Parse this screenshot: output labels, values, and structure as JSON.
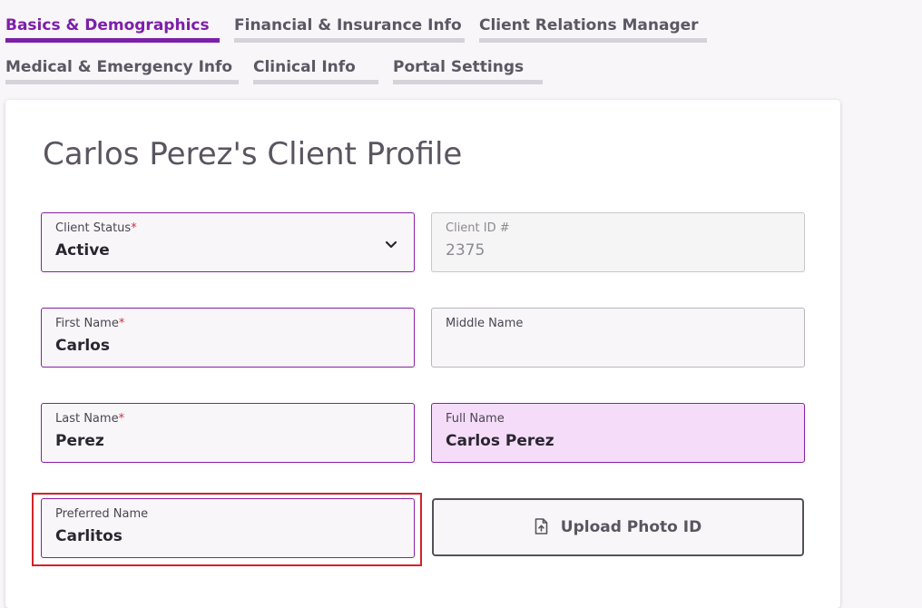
{
  "tabs": [
    {
      "label": "Basics & Demographics",
      "active": true
    },
    {
      "label": "Financial & Insurance Info",
      "active": false
    },
    {
      "label": "Client Relations Manager",
      "active": false
    },
    {
      "label": "Medical & Emergency Info",
      "active": false
    },
    {
      "label": "Clinical Info",
      "active": false
    },
    {
      "label": "Portal Settings",
      "active": false
    }
  ],
  "profile": {
    "title": "Carlos Perez's Client Profile",
    "client_status": {
      "label": "Client Status",
      "required_mark": "*",
      "value": "Active"
    },
    "client_id": {
      "label": "Client ID #",
      "value": "2375"
    },
    "first_name": {
      "label": "First Name",
      "required_mark": "*",
      "value": "Carlos"
    },
    "middle_name": {
      "label": "Middle Name",
      "value": ""
    },
    "last_name": {
      "label": "Last Name",
      "required_mark": "*",
      "value": "Perez"
    },
    "full_name": {
      "label": "Full Name",
      "value": "Carlos Perez"
    },
    "preferred_name": {
      "label": "Preferred Name",
      "value": "Carlitos"
    },
    "upload_button": {
      "label": "Upload Photo ID",
      "icon": "file-upload-icon"
    }
  },
  "colors": {
    "accent": "#7d1fa8",
    "required": "#d0313c",
    "focus_outline": "#d2232a",
    "full_name_bg": "#f5ddfa"
  }
}
